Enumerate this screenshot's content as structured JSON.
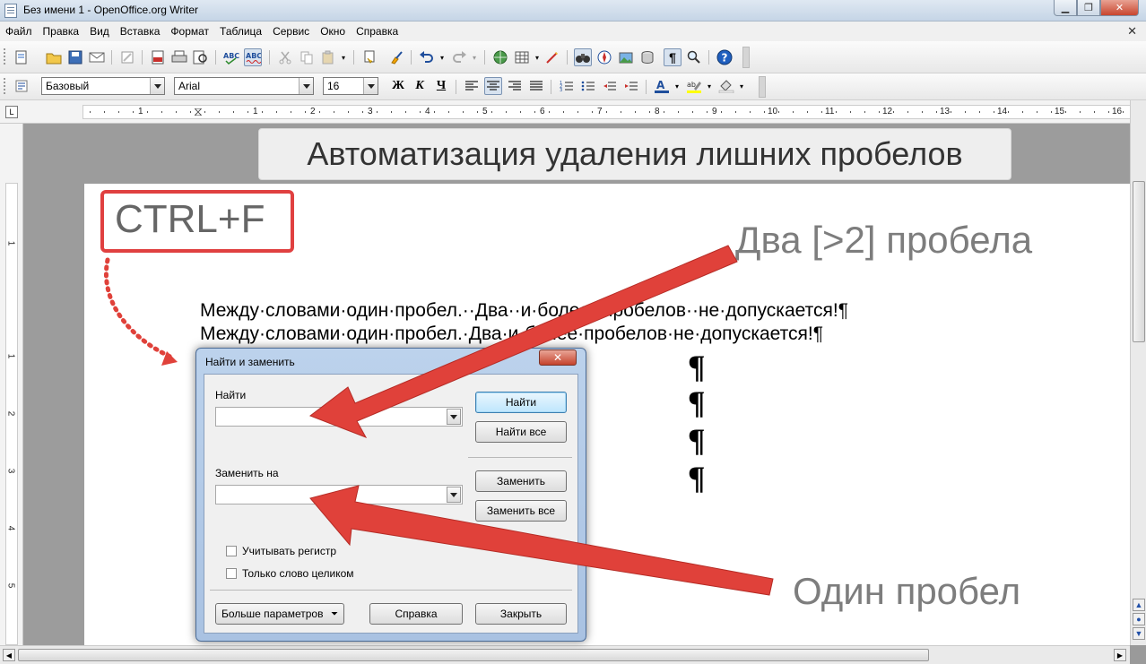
{
  "window": {
    "title": "Без имени 1 - OpenOffice.org Writer",
    "min_icon": "minimize-icon",
    "max_icon": "maximize-icon",
    "close_glyph": "✕"
  },
  "menu": {
    "items": [
      "Файл",
      "Правка",
      "Вид",
      "Вставка",
      "Формат",
      "Таблица",
      "Сервис",
      "Окно",
      "Справка"
    ],
    "doc_close": "✕"
  },
  "format_bar": {
    "style": "Базовый",
    "font": "Arial",
    "size": "16",
    "bold": "Ж",
    "italic": "К",
    "underline": "Ч"
  },
  "ruler": {
    "numbers": [
      "1",
      "1",
      "2",
      "3",
      "4",
      "5",
      "6",
      "7",
      "8",
      "9",
      "10",
      "11",
      "12",
      "13",
      "14",
      "15",
      "16"
    ],
    "vertical_numbers": [
      "1",
      "1",
      "2",
      "3",
      "4",
      "5"
    ],
    "corner": "L"
  },
  "banner": {
    "text": "Автоматизация удаления лишних пробелов"
  },
  "shortcut": {
    "text": "CTRL+F"
  },
  "annotations": {
    "two_spaces": "Два [>2] пробела",
    "one_space": "Один пробел"
  },
  "document": {
    "line1": "Между·словами·один·пробел.··Два··и·более··пробелов··не·допускается!¶",
    "line2": "Между·словами·один·пробел.·Два·и·более·пробелов·не·допускается!¶",
    "pilcrow": "¶"
  },
  "dialog": {
    "title": "Найти и заменить",
    "close": "✕",
    "find_label": "Найти",
    "find_value": "",
    "replace_label": "Заменить на",
    "replace_value": "",
    "btn_find": "Найти",
    "btn_find_all": "Найти все",
    "btn_replace": "Заменить",
    "btn_replace_all": "Заменить все",
    "chk_case": "Учитывать регистр",
    "chk_whole": "Только слово целиком",
    "btn_more": "Больше параметров",
    "btn_help": "Справка",
    "btn_close": "Закрыть"
  },
  "colors": {
    "annotation_red": "#e0413a",
    "annotation_gray": "#7d7d7d",
    "titlebar": "#c5d5e6"
  }
}
